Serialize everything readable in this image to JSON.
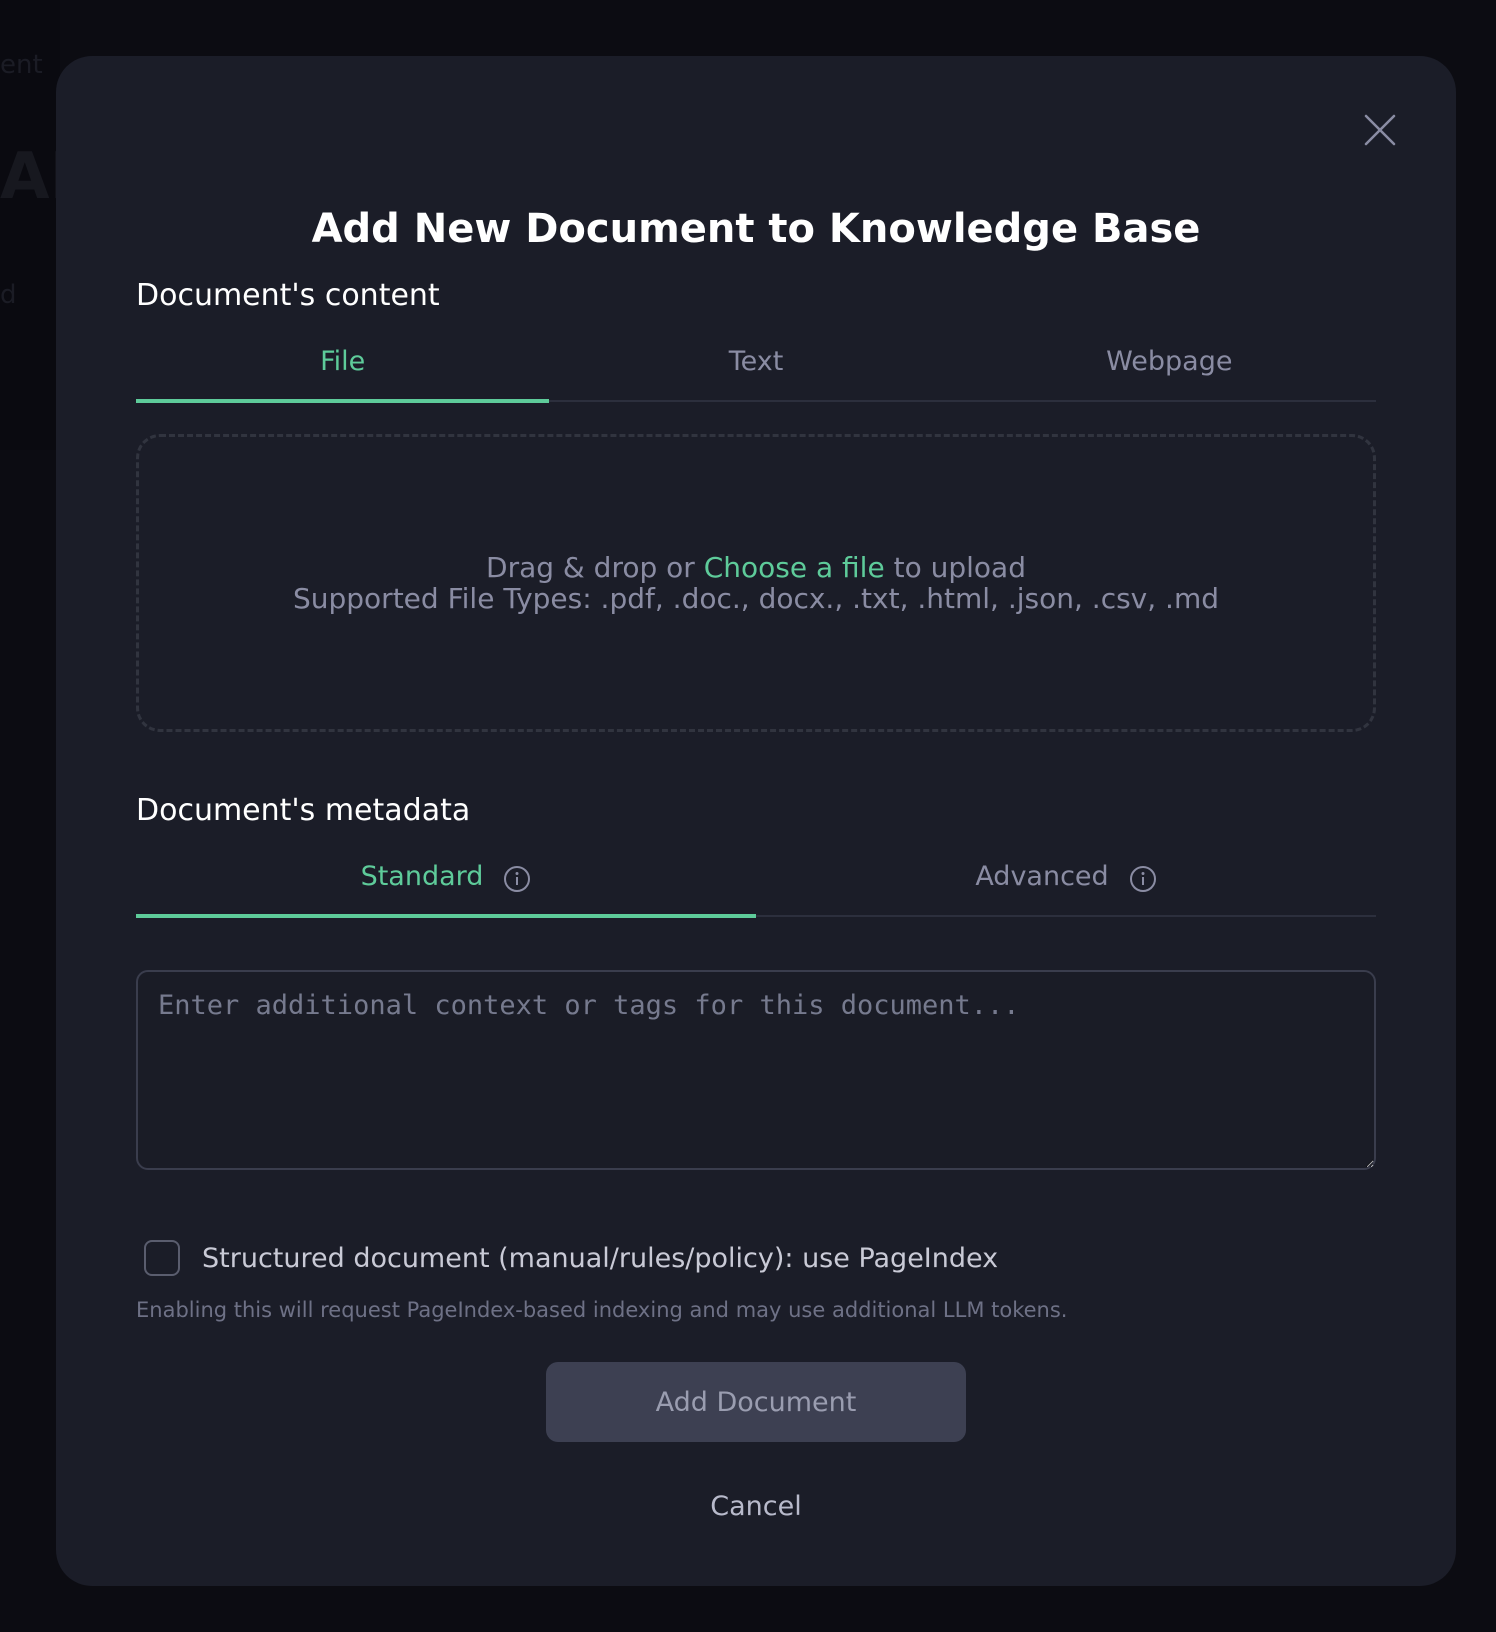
{
  "modal": {
    "title": "Add New Document to Knowledge Base",
    "close_icon": "close-icon"
  },
  "content_section": {
    "label": "Document's content",
    "tabs": [
      {
        "label": "File",
        "active": true
      },
      {
        "label": "Text",
        "active": false
      },
      {
        "label": "Webpage",
        "active": false
      }
    ],
    "dropzone": {
      "prefix": "Drag & drop or",
      "link": "Choose a file",
      "suffix": "to upload",
      "supported": "Supported File Types: .pdf, .doc., docx., .txt, .html, .json, .csv, .md"
    }
  },
  "metadata_section": {
    "label": "Document's metadata",
    "tabs": [
      {
        "label": "Standard",
        "active": true,
        "icon": "info-icon"
      },
      {
        "label": "Advanced",
        "active": false,
        "icon": "info-icon"
      }
    ],
    "input_placeholder": "Enter additional context or tags for this document...",
    "input_value": ""
  },
  "structured_option": {
    "label": "Structured document (manual/rules/policy): use PageIndex",
    "checked": false,
    "hint": "Enabling this will request PageIndex-based indexing and may use additional LLM tokens."
  },
  "actions": {
    "primary_label": "Add Document",
    "cancel_label": "Cancel"
  },
  "colors": {
    "accent": "#5ecb9a",
    "modal_bg": "#1b1d28",
    "backdrop": "#0c0c12"
  }
}
